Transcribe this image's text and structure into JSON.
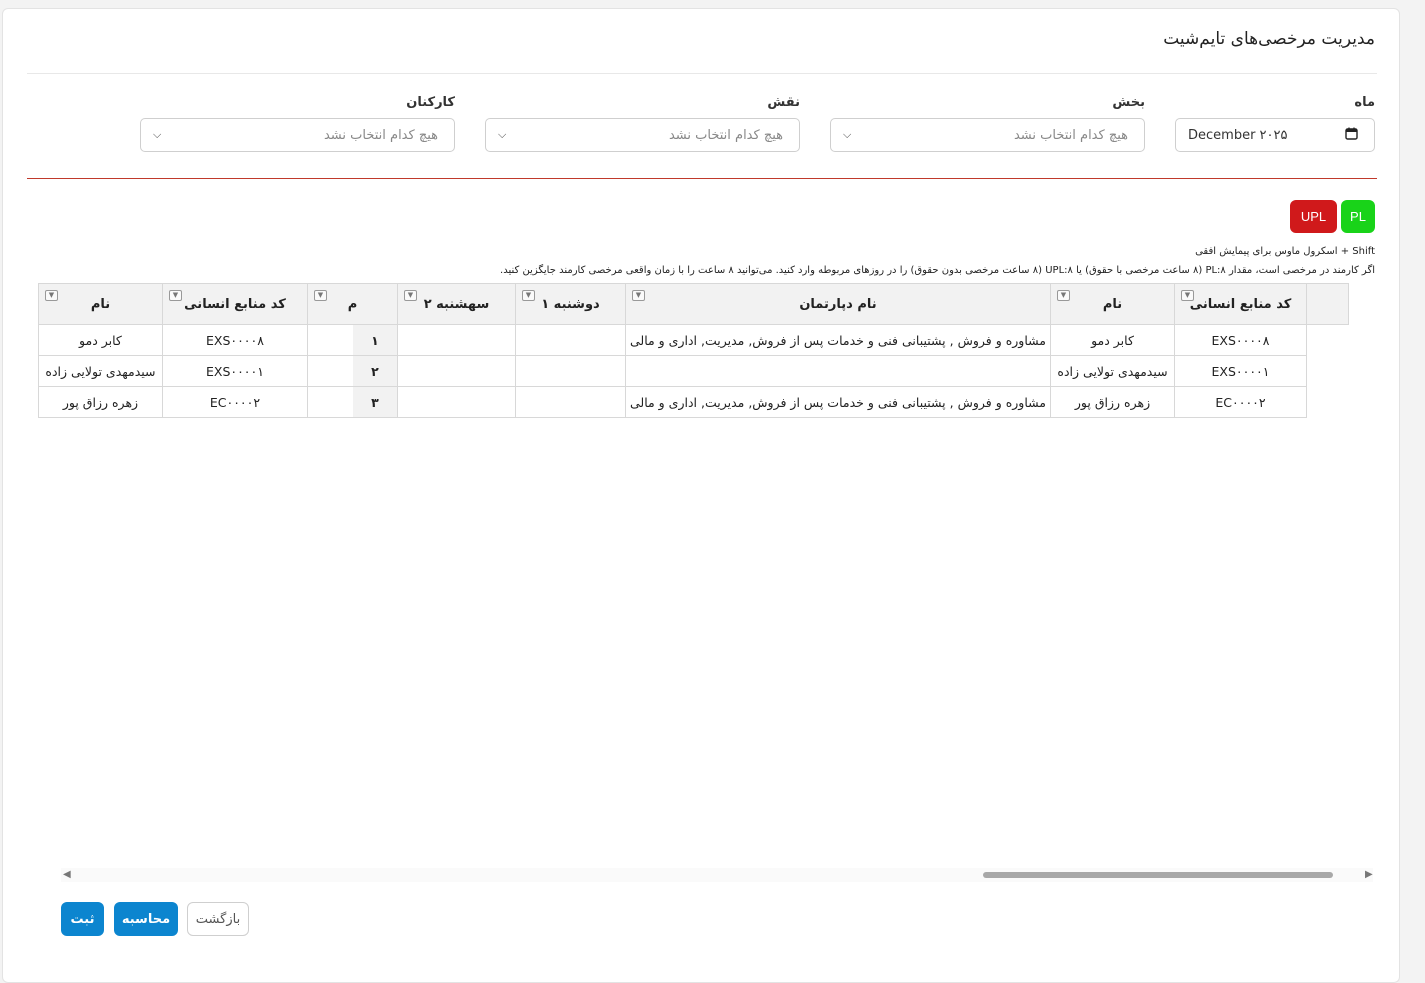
{
  "page": {
    "title": "مدیریت مرخصی‌های تایم‌شیت"
  },
  "filters": {
    "month": {
      "label": "ماه",
      "value": "December ۲۰۲۵"
    },
    "department": {
      "label": "بخش",
      "placeholder": "هیچ کدام انتخاب نشد"
    },
    "role": {
      "label": "نقش",
      "placeholder": "هیچ کدام انتخاب نشد"
    },
    "staff": {
      "label": "کارکنان",
      "placeholder": "هیچ کدام انتخاب نشد"
    }
  },
  "legend": {
    "pl": "PL",
    "upl": "UPL"
  },
  "hints": {
    "scroll": "Shift + اسکرول ماوس برای پیمایش افقی",
    "leave": "اگر کارمند در مرخصی است، مقدار PL:۸ (۸ ساعت مرخصی با حقوق) یا UPL:۸ (۸ ساعت مرخصی بدون حقوق) را در روزهای مربوطه وارد کنید. می‌توانید ۸ ساعت را با زمان واقعی مرخصی کارمند جایگزین کنید."
  },
  "grid": {
    "headers": {
      "hr_code": "کد منابع انسانی",
      "name": "نام",
      "dept": "نام دپارتمان",
      "mon1": "دوشنبه ۱",
      "tue2": "سهشنبه ۲",
      "row_no": "م",
      "left_hr_code": "کد منابع انسانی",
      "left_name": "نام"
    },
    "rows": [
      {
        "hr_code": "EXS۰۰۰۰۸",
        "name": "کابر دمو",
        "dept": "مشاوره و فروش , پشتیبانی فنی و خدمات پس از فروش, مدیریت, اداری و مالی",
        "mon1": "",
        "tue2": "",
        "row_no": "۱",
        "left_hr_code": "EXS۰۰۰۰۸",
        "left_name": "کابر دمو"
      },
      {
        "hr_code": "EXS۰۰۰۰۱",
        "name": "سیدمهدی تولایی زاده",
        "dept": "",
        "mon1": "",
        "tue2": "",
        "row_no": "۲",
        "left_hr_code": "EXS۰۰۰۰۱",
        "left_name": "سیدمهدی تولایی زاده"
      },
      {
        "hr_code": "EC۰۰۰۰۲",
        "name": "زهره رزاق پور",
        "dept": "مشاوره و فروش , پشتیبانی فنی و خدمات پس از فروش, مدیریت, اداری و مالی",
        "mon1": "",
        "tue2": "",
        "row_no": "۳",
        "left_hr_code": "EC۰۰۰۰۲",
        "left_name": "زهره رزاق پور"
      }
    ]
  },
  "actions": {
    "save": "ثبت",
    "calculate": "محاسبه",
    "back": "بازگشت"
  },
  "colors": {
    "primary": "#0c85cf",
    "pl": "#19d319",
    "upl": "#d0191b",
    "divider": "#c0392b"
  }
}
